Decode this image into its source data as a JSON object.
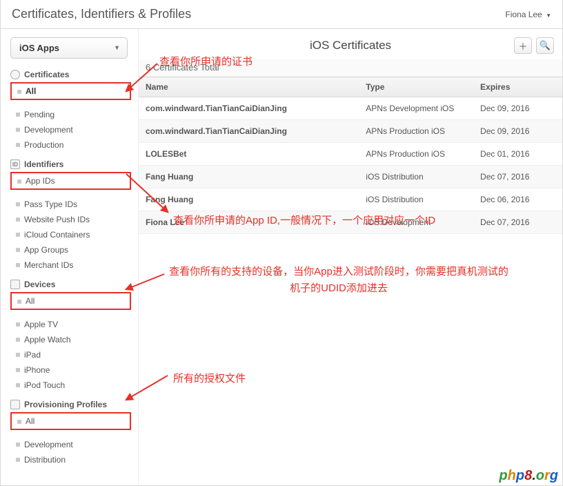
{
  "header": {
    "title": "Certificates, Identifiers & Profiles",
    "user": "Fiona Lee"
  },
  "app_selector": {
    "selected": "iOS Apps"
  },
  "sidebar": {
    "sections": [
      {
        "title": "Certificates",
        "badge_shape": "round",
        "items": [
          {
            "label": "All",
            "selected": true,
            "hl": true
          },
          {
            "label": "Pending"
          },
          {
            "label": "Development"
          },
          {
            "label": "Production"
          }
        ]
      },
      {
        "title": "Identifiers",
        "badge_shape": "square",
        "badge_text": "ID",
        "items": [
          {
            "label": "App IDs",
            "hl": true
          },
          {
            "label": "Pass Type IDs"
          },
          {
            "label": "Website Push IDs"
          },
          {
            "label": "iCloud Containers"
          },
          {
            "label": "App Groups"
          },
          {
            "label": "Merchant IDs"
          }
        ]
      },
      {
        "title": "Devices",
        "badge_shape": "square",
        "items": [
          {
            "label": "All",
            "hl": true
          },
          {
            "label": "Apple TV"
          },
          {
            "label": "Apple Watch"
          },
          {
            "label": "iPad"
          },
          {
            "label": "iPhone"
          },
          {
            "label": "iPod Touch"
          }
        ]
      },
      {
        "title": "Provisioning Profiles",
        "badge_shape": "square",
        "items": [
          {
            "label": "All",
            "hl": true
          },
          {
            "label": "Development"
          },
          {
            "label": "Distribution"
          }
        ]
      }
    ]
  },
  "main": {
    "title": "iOS Certificates",
    "subtitle": "6 Certificates Total",
    "columns": {
      "name": "Name",
      "type": "Type",
      "expires": "Expires"
    },
    "rows": [
      {
        "name": "com.windward.TianTianCaiDianJing",
        "type": "APNs Development iOS",
        "expires": "Dec 09, 2016"
      },
      {
        "name": "com.windward.TianTianCaiDianJing",
        "type": "APNs Production iOS",
        "expires": "Dec 09, 2016"
      },
      {
        "name": "LOLESBet",
        "type": "APNs Production iOS",
        "expires": "Dec 01, 2016"
      },
      {
        "name": "Fang Huang",
        "type": "iOS Distribution",
        "expires": "Dec 07, 2016"
      },
      {
        "name": "Fang Huang",
        "type": "iOS Distribution",
        "expires": "Dec 06, 2016"
      },
      {
        "name": "Fiona Lee",
        "type": "iOS Development",
        "expires": "Dec 07, 2016"
      }
    ]
  },
  "annotations": {
    "a1": "查看你所申请的证书",
    "a2": "查看你所申请的App ID,一般情况下，一个应用对应一个ID",
    "a3": "查看你所有的支持的设备，当你App进入测试阶段时，你需要把真机测试的机子的UDID添加进去",
    "a4": "所有的授权文件"
  },
  "watermark": "php8.org"
}
